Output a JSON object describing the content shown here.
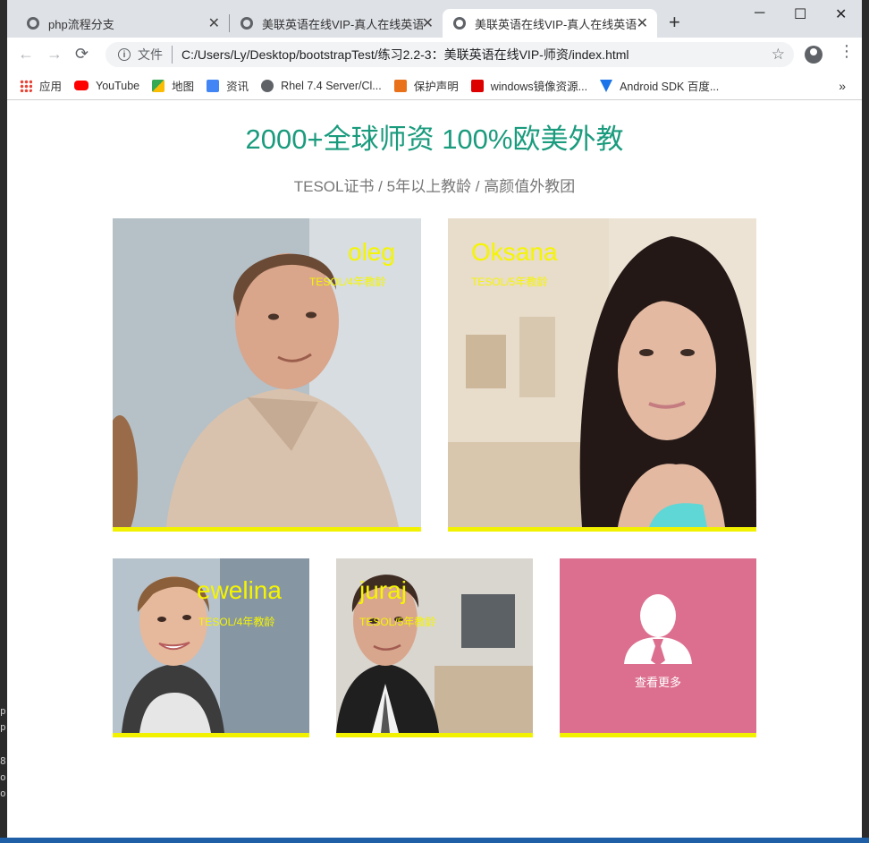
{
  "browser": {
    "tabs": [
      {
        "title": "php流程分支",
        "close": "✕"
      },
      {
        "title": "美联英语在线VIP-真人在线英语学",
        "close": "✕"
      },
      {
        "title": "美联英语在线VIP-真人在线英语学",
        "close": "✕"
      }
    ],
    "new_tab": "+",
    "window_controls": {
      "minimize": "─",
      "maximize": "☐",
      "close": "✕"
    },
    "nav": {
      "back": "←",
      "forward": "→",
      "reload": "⟳"
    },
    "omnibox": {
      "scheme_label": "文件",
      "url": "C:/Users/Ly/Desktop/bootstrapTest/练习2.2-3：美联英语在线VIP-师资/index.html",
      "star": "☆",
      "info": "i"
    },
    "menu": "⋮",
    "bookmarks": [
      {
        "label": "应用",
        "icon": "apps-grid-icon",
        "color": "#e94235"
      },
      {
        "label": "YouTube",
        "icon": "youtube-icon",
        "color": "#ff0000"
      },
      {
        "label": "地图",
        "icon": "maps-icon",
        "color": "#34a853"
      },
      {
        "label": "资讯",
        "icon": "news-icon",
        "color": "#4285f4"
      },
      {
        "label": "Rhel 7.4 Server/Cl...",
        "icon": "globe-icon",
        "color": "#5f6368"
      },
      {
        "label": "保护声明",
        "icon": "protection-icon",
        "color": "#e8711a"
      },
      {
        "label": "windows镜像资源...",
        "icon": "c-logo-icon",
        "color": "#d00"
      },
      {
        "label": "Android SDK 百度...",
        "icon": "funnel-icon",
        "color": "#1a73e8"
      }
    ],
    "bookmarks_more": "»"
  },
  "page": {
    "headline": "2000+全球师资 100%欧美外教",
    "subhead": "TESOL证书 / 5年以上教龄 / 高颜值外教团",
    "teachers": [
      {
        "name": "oleg",
        "meta": "TESOL/4年教龄"
      },
      {
        "name": "Oksana",
        "meta": "TESOL/5年教龄"
      },
      {
        "name": "ewelina",
        "meta": "TESOL/4年教龄"
      },
      {
        "name": "juraj",
        "meta": "TESOL/5年教龄"
      }
    ],
    "more": {
      "label": "查看更多",
      "icon": "person-tie-icon"
    }
  },
  "desktop_text": [
    "p",
    "p",
    "8",
    "o",
    "o"
  ],
  "colors": {
    "accent": "#1a9b7d",
    "highlight": "#f5f500",
    "more_bg": "#dc6f8f"
  }
}
